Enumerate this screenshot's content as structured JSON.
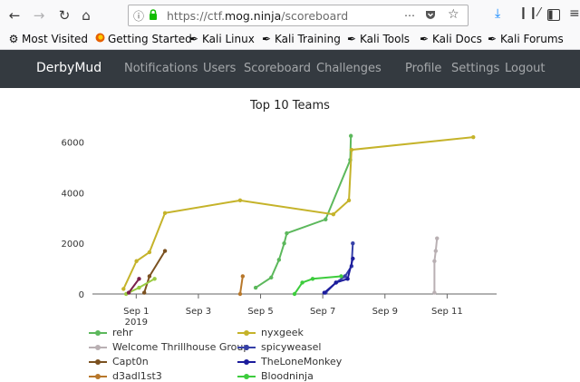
{
  "browser": {
    "url_host_prefix": "https://ctf.",
    "url_host_domain": "mog.ninja",
    "url_path": "/scoreboard",
    "bookmarks": [
      {
        "label": "Most Visited",
        "icon": "gear-icon"
      },
      {
        "label": "Getting Started",
        "icon": "firefox-icon"
      },
      {
        "label": "Kali Linux",
        "icon": "kali-dragon-icon"
      },
      {
        "label": "Kali Training",
        "icon": "kali-dragon-icon"
      },
      {
        "label": "Kali Tools",
        "icon": "kali-dragon-icon"
      },
      {
        "label": "Kali Docs",
        "icon": "kali-dragon-icon"
      },
      {
        "label": "Kali Forums",
        "icon": "kali-dragon-icon"
      }
    ]
  },
  "site": {
    "brand": "DerbyMud",
    "nav_left": [
      "Notifications",
      "Users",
      "Scoreboard",
      "Challenges"
    ],
    "nav_right": [
      "Profile",
      "Settings",
      "Logout"
    ]
  },
  "chart_data": {
    "type": "line",
    "title": "Top 10 Teams",
    "xlabel": "",
    "ylabel": "",
    "x_ticks": [
      "Sep 1\n2019",
      "Sep 3",
      "Sep 5",
      "Sep 7",
      "Sep 9",
      "Sep 11"
    ],
    "xlim": [
      "2019-08-31T00:00",
      "2019-09-13T00:00"
    ],
    "y_ticks": [
      0,
      2000,
      4000,
      6000
    ],
    "ylim": [
      0,
      6600
    ],
    "grid": false,
    "legend_position": "bottom",
    "series": [
      {
        "name": "rehr",
        "color": "#5cb85c",
        "points": [
          [
            "2019-09-05T06:00",
            250
          ],
          [
            "2019-09-05T18:00",
            650
          ],
          [
            "2019-09-06T00:00",
            1350
          ],
          [
            "2019-09-06T04:00",
            2000
          ],
          [
            "2019-09-06T06:00",
            2400
          ],
          [
            "2019-09-07T12:00",
            2950
          ],
          [
            "2019-09-08T07:00",
            5300
          ],
          [
            "2019-09-08T07:30",
            6250
          ]
        ]
      },
      {
        "name": "nyxgeek",
        "color": "#c5b32a",
        "points": [
          [
            "2019-09-01T00:00",
            200
          ],
          [
            "2019-09-01T10:00",
            1300
          ],
          [
            "2019-09-01T20:00",
            1650
          ],
          [
            "2019-09-02T08:00",
            3200
          ],
          [
            "2019-09-04T18:00",
            3700
          ],
          [
            "2019-09-07T18:00",
            3150
          ],
          [
            "2019-09-08T06:00",
            3700
          ],
          [
            "2019-09-08T08:00",
            5700
          ],
          [
            "2019-09-12T06:00",
            6200
          ]
        ]
      },
      {
        "name": "Welcome Thrillhouse Group",
        "color": "#b9b0b3",
        "points": [
          [
            "2019-09-11T00:00",
            50
          ],
          [
            "2019-09-11T00:00",
            1300
          ],
          [
            "2019-09-11T01:00",
            1700
          ],
          [
            "2019-09-11T02:00",
            2200
          ]
        ]
      },
      {
        "name": "spicyweasel",
        "color": "#3640a8",
        "points": [
          [
            "2019-09-07T12:00",
            50
          ],
          [
            "2019-09-07T20:00",
            450
          ],
          [
            "2019-09-08T03:00",
            700
          ],
          [
            "2019-09-08T08:00",
            1100
          ],
          [
            "2019-09-08T09:00",
            2000
          ]
        ]
      },
      {
        "name": "Capt0n",
        "color": "#7b5120",
        "points": [
          [
            "2019-09-01T16:00",
            50
          ],
          [
            "2019-09-01T20:00",
            700
          ],
          [
            "2019-09-02T08:00",
            1700
          ]
        ]
      },
      {
        "name": "TheLoneMonkey",
        "color": "#1c1c9c",
        "points": [
          [
            "2019-09-07T11:00",
            50
          ],
          [
            "2019-09-07T20:00",
            450
          ],
          [
            "2019-09-08T05:00",
            600
          ],
          [
            "2019-09-08T09:00",
            1400
          ]
        ]
      },
      {
        "name": "d3adl1st3",
        "color": "#b7772a",
        "points": [
          [
            "2019-09-04T18:00",
            0
          ],
          [
            "2019-09-04T20:00",
            700
          ]
        ]
      },
      {
        "name": "Bloodninja",
        "color": "#3dcc3d",
        "points": [
          [
            "2019-09-06T12:00",
            0
          ],
          [
            "2019-09-06T18:00",
            450
          ],
          [
            "2019-09-07T02:00",
            600
          ],
          [
            "2019-09-08T00:00",
            700
          ]
        ]
      },
      {
        "name": "",
        "color": "#9acb42",
        "points": [
          [
            "2019-09-01T02:00",
            0
          ],
          [
            "2019-09-01T12:00",
            250
          ],
          [
            "2019-09-02T00:00",
            600
          ]
        ]
      },
      {
        "name": "",
        "color": "#7a1f4a",
        "points": [
          [
            "2019-09-01T04:00",
            50
          ],
          [
            "2019-09-01T12:00",
            600
          ]
        ]
      }
    ]
  }
}
